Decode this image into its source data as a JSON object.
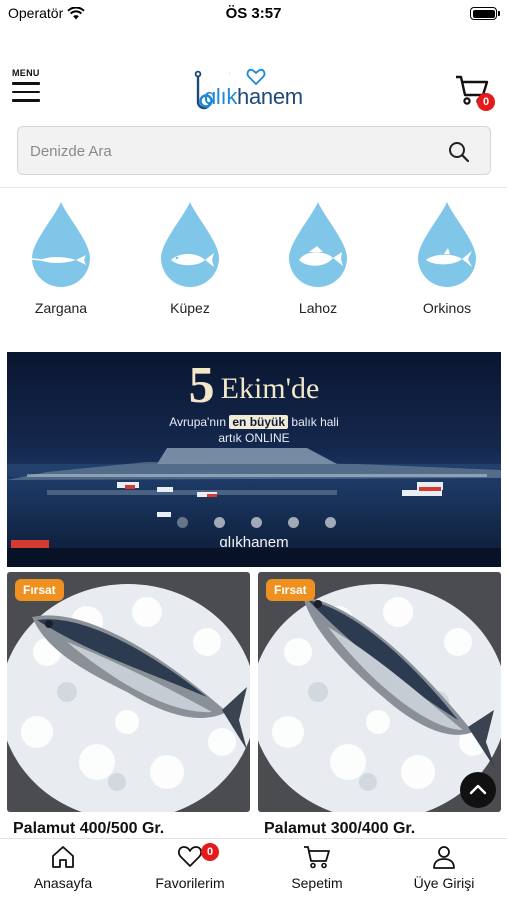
{
  "status_bar": {
    "carrier": "Operatör",
    "time": "ÖS 3:57"
  },
  "header": {
    "menu_label": "MENU",
    "logo_text_1": "ɑlık",
    "logo_text_2": "hanem",
    "cart_count": "0"
  },
  "search": {
    "placeholder": "Denizde Ara"
  },
  "categories": [
    {
      "label": "Zargana",
      "icon": "needlefish-drop-icon"
    },
    {
      "label": "Küpez",
      "icon": "fish-drop-icon"
    },
    {
      "label": "Lahoz",
      "icon": "grouper-drop-icon"
    },
    {
      "label": "Orkinos",
      "icon": "tuna-drop-icon"
    }
  ],
  "banner": {
    "day": "5",
    "month": "Ekim'de",
    "line1_a": "Avrupa'nın",
    "line1_highlight": "en büyük",
    "line1_b": "balık hali",
    "line2": "artık ONLINE",
    "logo": "ɑlıkhanem",
    "slide_count": 5,
    "active_slide": 1
  },
  "products": [
    {
      "badge": "Fırsat",
      "title": "Palamut 400/500 Gr."
    },
    {
      "badge": "Fırsat",
      "title": "Palamut 300/400 Gr."
    }
  ],
  "bottom_nav": [
    {
      "label": "Anasayfa",
      "icon": "home-icon"
    },
    {
      "label": "Favorilerim",
      "icon": "heart-icon",
      "badge": "0"
    },
    {
      "label": "Sepetim",
      "icon": "cart-icon"
    },
    {
      "label": "Üye Girişi",
      "icon": "user-icon"
    }
  ],
  "colors": {
    "badge_red": "#e31b1b",
    "deal_orange": "#ee9121",
    "drop_blue": "#7fc6e8",
    "brand_blue": "#1e4a7a"
  }
}
